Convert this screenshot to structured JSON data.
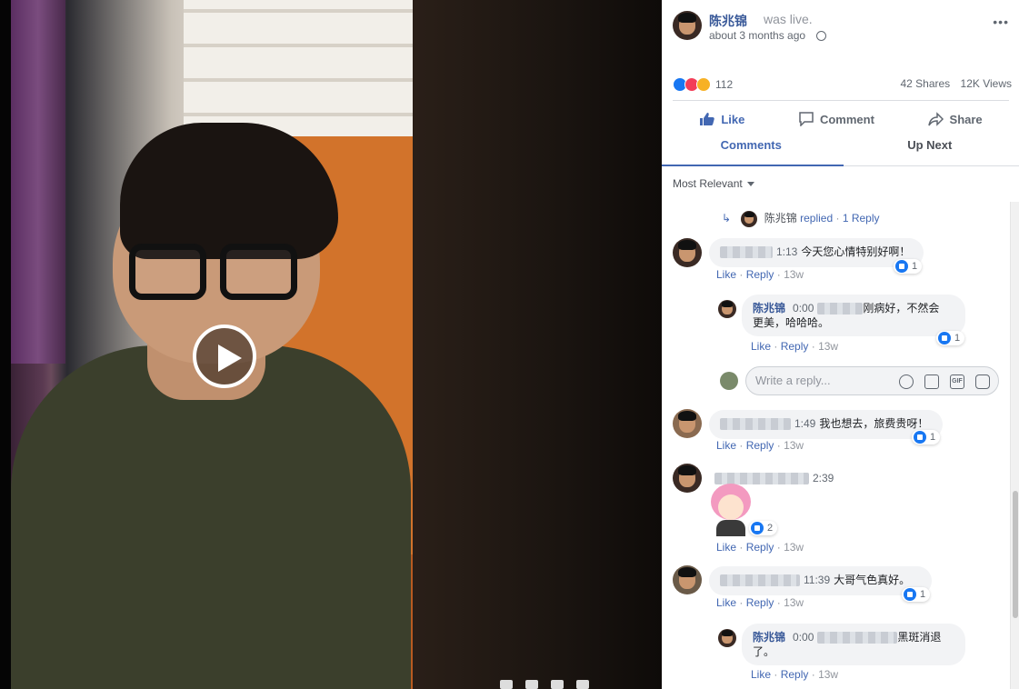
{
  "post": {
    "author": "陈兆锦",
    "status": "was live.",
    "time": "about 3 months ago"
  },
  "engagement": {
    "reaction_count": "112",
    "shares": "42 Shares",
    "views": "12K Views"
  },
  "actions": {
    "like": "Like",
    "comment": "Comment",
    "share": "Share"
  },
  "tabs": {
    "comments": "Comments",
    "up_next": "Up Next"
  },
  "sort_label": "Most Relevant",
  "comments": {
    "reply_summary": {
      "name": "陈兆锦",
      "verb": "replied",
      "count": "1 Reply"
    },
    "c1": {
      "time": "1:13",
      "text": "今天您心情特别好啊！",
      "likes": "1",
      "like": "Like",
      "reply": "Reply",
      "age": "13w"
    },
    "r1": {
      "name": "陈兆锦",
      "time": "0:00",
      "text1": "刚病好，不然会",
      "text2": "更美，哈哈哈。",
      "likes": "1",
      "like": "Like",
      "reply": "Reply",
      "age": "13w"
    },
    "reply_box": {
      "placeholder": "Write a reply..."
    },
    "c2": {
      "time": "1:49",
      "text": "我也想去，旅费贵呀！",
      "likes": "1",
      "like": "Like",
      "reply": "Reply",
      "age": "13w"
    },
    "c3": {
      "time": "2:39",
      "likes": "2",
      "like": "Like",
      "reply": "Reply",
      "age": "13w"
    },
    "c4": {
      "time": "11:39",
      "text": "大哥气色真好。",
      "likes": "1",
      "like": "Like",
      "reply": "Reply",
      "age": "13w"
    },
    "r2": {
      "name": "陈兆锦",
      "time": "0:00",
      "text1": "黑斑消退",
      "text2": "了。",
      "like": "Like",
      "reply": "Reply",
      "age": "13w"
    }
  },
  "icons": {
    "like": "thumbs-up-icon",
    "comment": "speech-bubble-icon",
    "share": "share-arrow-icon",
    "audience": "globe-icon",
    "more": "more-dots-icon"
  },
  "colors": {
    "link": "#385898",
    "accent": "#4267b2",
    "like_blue": "#1877f2",
    "love_red": "#f33e58",
    "haha_yellow": "#f7b125"
  }
}
